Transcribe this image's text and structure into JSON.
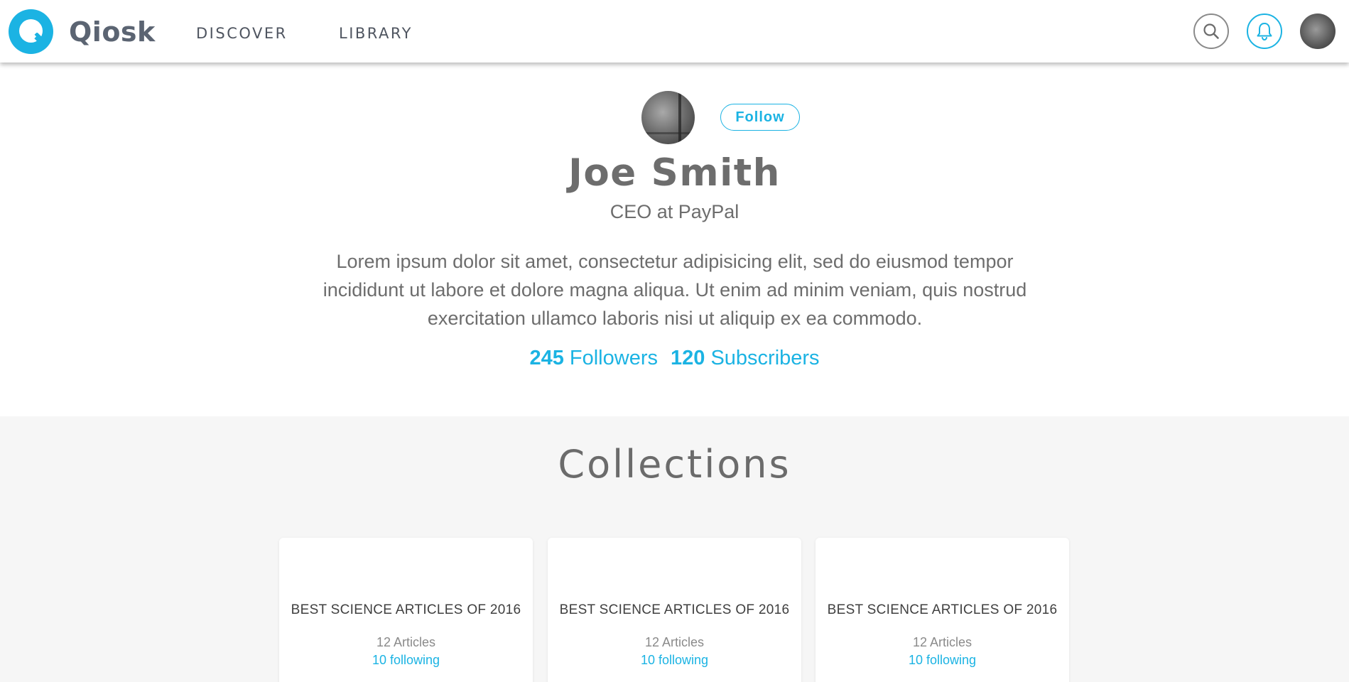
{
  "header": {
    "logo_text": "Qiosk",
    "nav": [
      {
        "label": "DISCOVER"
      },
      {
        "label": "LIBRARY"
      }
    ],
    "icons": [
      "search-icon",
      "bell-icon",
      "user-avatar"
    ]
  },
  "profile": {
    "name": "Joe Smith",
    "role": "CEO at PayPal",
    "bio": "Lorem ipsum dolor sit amet, consectetur adipisicing elit, sed do eiusmod tempor incididunt ut labore et dolore magna aliqua. Ut enim ad minim veniam, quis nostrud exercitation ullamco laboris nisi ut aliquip ex ea commodo.",
    "follow_label": "Follow",
    "followers_count": "245",
    "followers_label": "Followers",
    "subscribers_count": "120",
    "subscribers_label": "Subscribers"
  },
  "collections": {
    "title": "Collections",
    "items": [
      {
        "title": "BEST SCIENCE ARTICLES OF 2016",
        "articles": "12 Articles",
        "following": "10 following"
      },
      {
        "title": "BEST SCIENCE ARTICLES OF 2016",
        "articles": "12 Articles",
        "following": "10 following"
      },
      {
        "title": "BEST SCIENCE ARTICLES OF 2016",
        "articles": "12 Articles",
        "following": "10 following"
      }
    ]
  },
  "colors": {
    "accent": "#1bb3e3",
    "text": "#6b6b6b",
    "background": "#f6f6f6"
  }
}
